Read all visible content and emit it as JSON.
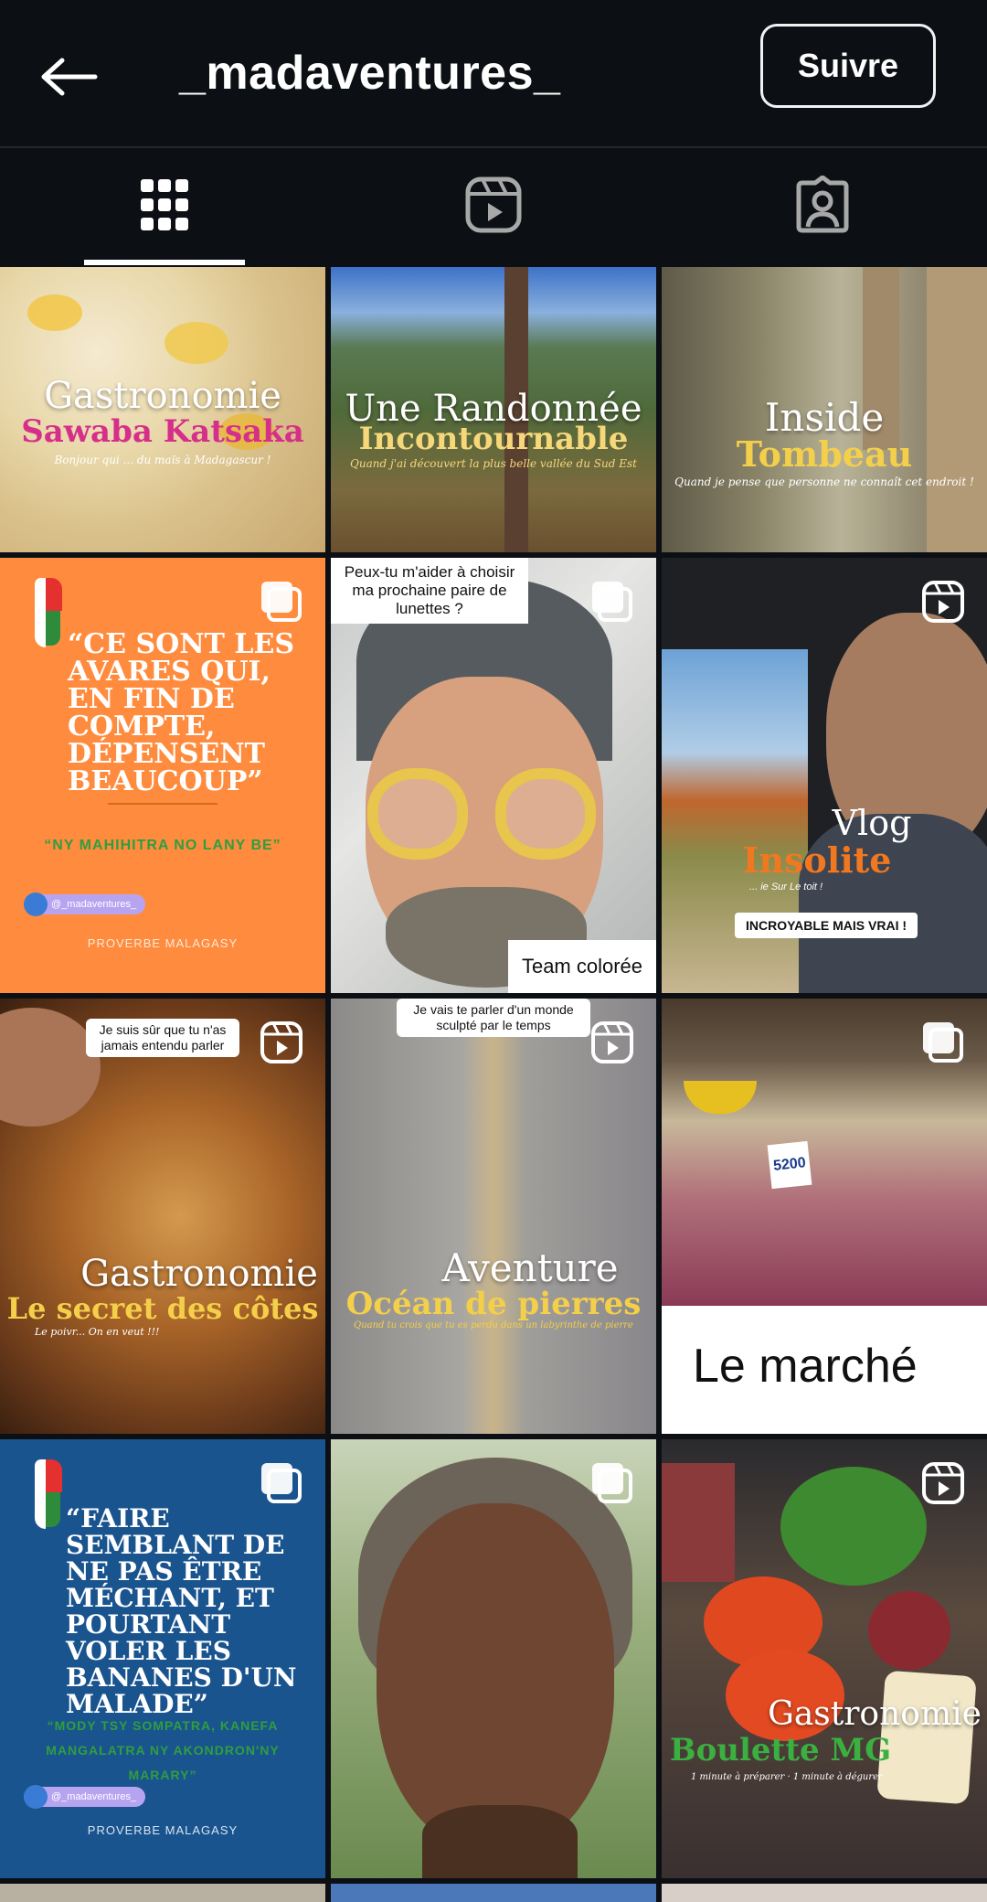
{
  "header": {
    "username": "_madaventures_",
    "follow_label": "Suivre"
  },
  "tabs": [
    {
      "name": "posts",
      "icon": "grid-icon",
      "active": true
    },
    {
      "name": "reels",
      "icon": "reels-icon",
      "active": false
    },
    {
      "name": "tagged",
      "icon": "tagged-person-icon",
      "active": false
    }
  ],
  "posts": [
    {
      "title": "Gastronomie",
      "subtitle": "Sawaba Katsaka",
      "caption": "Bonjour qui ... du maïs à Madagascur !"
    },
    {
      "title": "Une Randonnée",
      "subtitle": "Incontournable",
      "caption": "Quand j'ai découvert la plus belle vallée du Sud Est"
    },
    {
      "title": "Inside",
      "subtitle": "Tombeau",
      "caption": "Quand je pense que personne ne connaît cet endroit !"
    },
    {
      "quote": "“CE SONT LES AVARES QUI, EN FIN DE COMPTE, DÉPENSENT BEAUCOUP”",
      "malagasy": "“NY MAHIHITRA NO LANY BE”",
      "handle": "@_madaventures_",
      "footer": "PROVERBE MALAGASY",
      "icon": "carousel-icon"
    },
    {
      "question": "Peux-tu m'aider à choisir ma prochaine paire de lunettes ?",
      "label": "Team colorée",
      "icon": "carousel-icon"
    },
    {
      "title": "Vlog",
      "subtitle": "Insolite",
      "caption": "... ie Sur Le toit !",
      "badge": "INCROYABLE MAIS VRAI !",
      "icon": "reels-icon"
    },
    {
      "bubble": "Je suis sûr que tu n'as jamais entendu parler",
      "title": "Gastronomie",
      "subtitle": "Le secret des côtes",
      "caption": "Le poivr... On en veut !!!",
      "icon": "reels-icon"
    },
    {
      "bubble": "Je vais te parler d'un monde sculpté par le temps",
      "title": "Aventure",
      "subtitle": "Océan de pierres",
      "caption": "Quand tu crois que tu es perdu dans un labyrinthe de pierre",
      "icon": "reels-icon"
    },
    {
      "price": "5200",
      "label": "Le marché",
      "icon": "carousel-icon"
    },
    {
      "quote": "“FAIRE SEMBLANT DE NE PAS ÊTRE MÉCHANT, ET POURTANT VOLER LES BANANES D'UN MALADE”",
      "malagasy": "“MODY TSY SOMPATRA, KANEFA MANGALATRA NY AKONDRON'NY MARARY”",
      "handle": "@_madaventures_",
      "footer": "PROVERBE MALAGASY",
      "icon": "carousel-icon"
    },
    {
      "icon": "carousel-icon"
    },
    {
      "title": "Gastronomie",
      "subtitle": "Boulette MG",
      "caption": "1 minute à préparer · 1 minute à dégurer",
      "icon": "reels-icon"
    }
  ],
  "colors": {
    "background": "#0c1014",
    "orange_tile": "#ff8c3e",
    "blue_tile": "#1a548e",
    "green_text": "#2f9e3f",
    "purple_pill": "#b7a4f0"
  }
}
